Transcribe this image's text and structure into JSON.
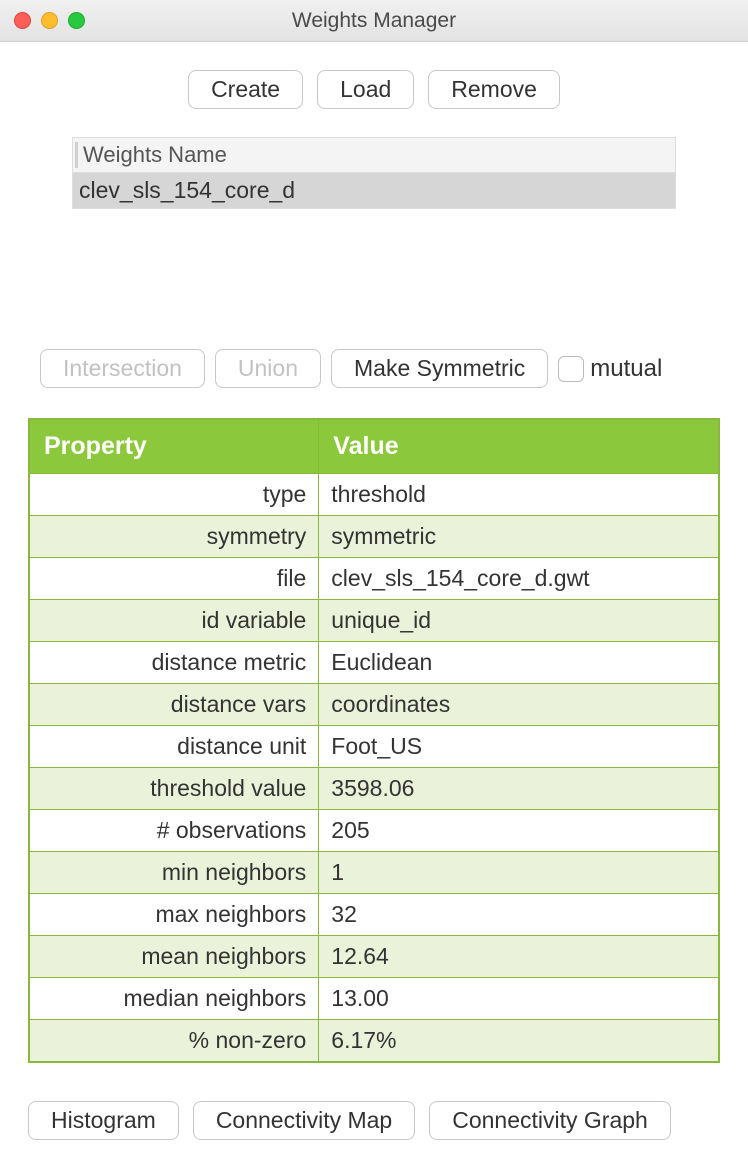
{
  "window": {
    "title": "Weights Manager"
  },
  "toolbar": {
    "create_label": "Create",
    "load_label": "Load",
    "remove_label": "Remove"
  },
  "list": {
    "header": "Weights Name",
    "rows": [
      "clev_sls_154_core_d"
    ]
  },
  "mid": {
    "intersection_label": "Intersection",
    "union_label": "Union",
    "make_symmetric_label": "Make Symmetric",
    "mutual_label": "mutual",
    "mutual_checked": false
  },
  "table": {
    "headers": {
      "property": "Property",
      "value": "Value"
    },
    "rows": [
      {
        "k": "type",
        "v": "threshold"
      },
      {
        "k": "symmetry",
        "v": "symmetric"
      },
      {
        "k": "file",
        "v": "clev_sls_154_core_d.gwt"
      },
      {
        "k": "id variable",
        "v": "unique_id"
      },
      {
        "k": "distance metric",
        "v": "Euclidean"
      },
      {
        "k": "distance vars",
        "v": "coordinates"
      },
      {
        "k": "distance unit",
        "v": "Foot_US"
      },
      {
        "k": "threshold value",
        "v": "3598.06"
      },
      {
        "k": "# observations",
        "v": "205"
      },
      {
        "k": "min neighbors",
        "v": "1"
      },
      {
        "k": "max neighbors",
        "v": "32"
      },
      {
        "k": "mean neighbors",
        "v": "12.64"
      },
      {
        "k": "median neighbors",
        "v": "13.00"
      },
      {
        "k": "% non-zero",
        "v": "6.17%"
      }
    ]
  },
  "bottom": {
    "histogram_label": "Histogram",
    "conn_map_label": "Connectivity Map",
    "conn_graph_label": "Connectivity Graph"
  }
}
